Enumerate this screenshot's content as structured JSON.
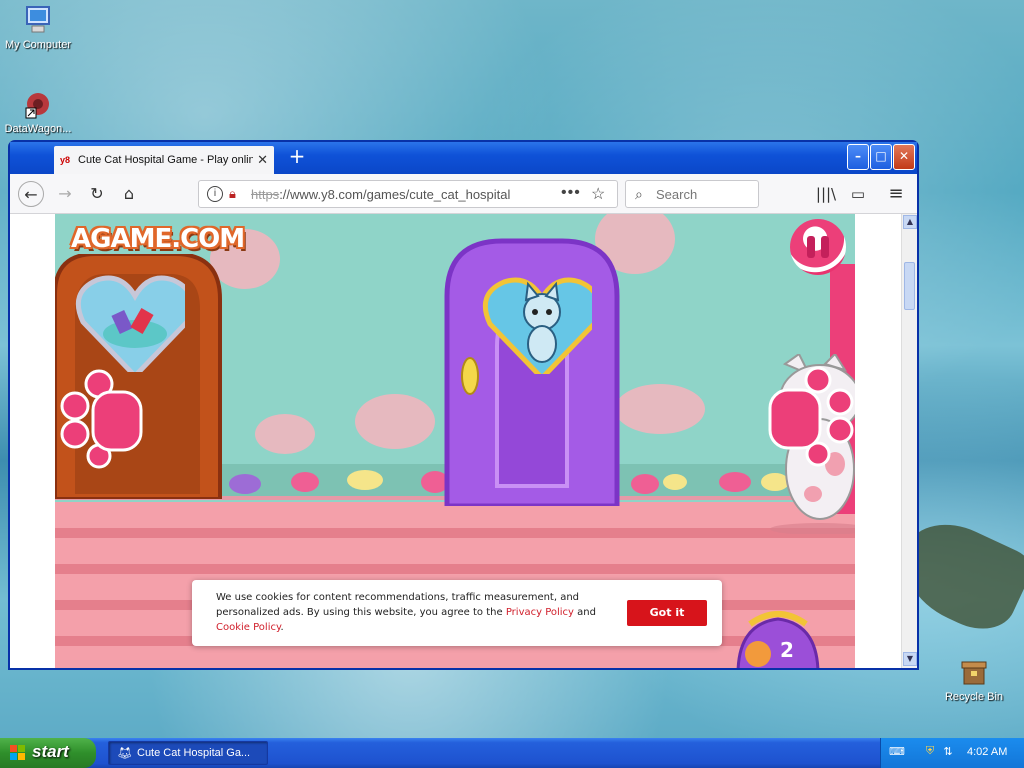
{
  "desktop": {
    "icons": [
      {
        "label": "My Computer",
        "icon": "computer-icon"
      },
      {
        "label": "DataWagon...",
        "icon": "datawagon-icon"
      },
      {
        "label": "Recycle Bin",
        "icon": "recycle-bin-icon"
      }
    ]
  },
  "browser": {
    "tab": {
      "favicon": "y8",
      "title": "Cute Cat Hospital Game - Play online",
      "close": "✕"
    },
    "new_tab": "+",
    "window_buttons": {
      "minimize": "–",
      "maximize": "□",
      "close": "✕"
    },
    "nav": {
      "back": "←",
      "forward": "→",
      "reload": "↻",
      "home": "⌂"
    },
    "address": {
      "scheme": "https",
      "rest": "://www.y8.com/games/cute_cat_hospital",
      "menu": "•••",
      "bookmark": "☆"
    },
    "search": {
      "placeholder": "Search",
      "icon": "⌕"
    },
    "toolbar": {
      "library": "|||\\",
      "sidebar": "▭",
      "menu": "≡"
    }
  },
  "game": {
    "logo": "AGAME.COM",
    "counter": "2",
    "cookie": {
      "text_before": "We use cookies for content recommendations, traffic measurement, and personalized ads. By using this website, you agree to the ",
      "privacy_link": "Privacy Policy",
      "and": " and ",
      "cookie_link": "Cookie Policy",
      "period": ".",
      "button": "Got it"
    },
    "colors": {
      "wall": "#8fd4c8",
      "door_left": "#c2521b",
      "door_center": "#a45be6",
      "accent_pink": "#e9336f"
    }
  },
  "taskbar": {
    "start": "start",
    "task_label": "Cute Cat Hospital Ga...",
    "clock": "4:02 AM"
  }
}
